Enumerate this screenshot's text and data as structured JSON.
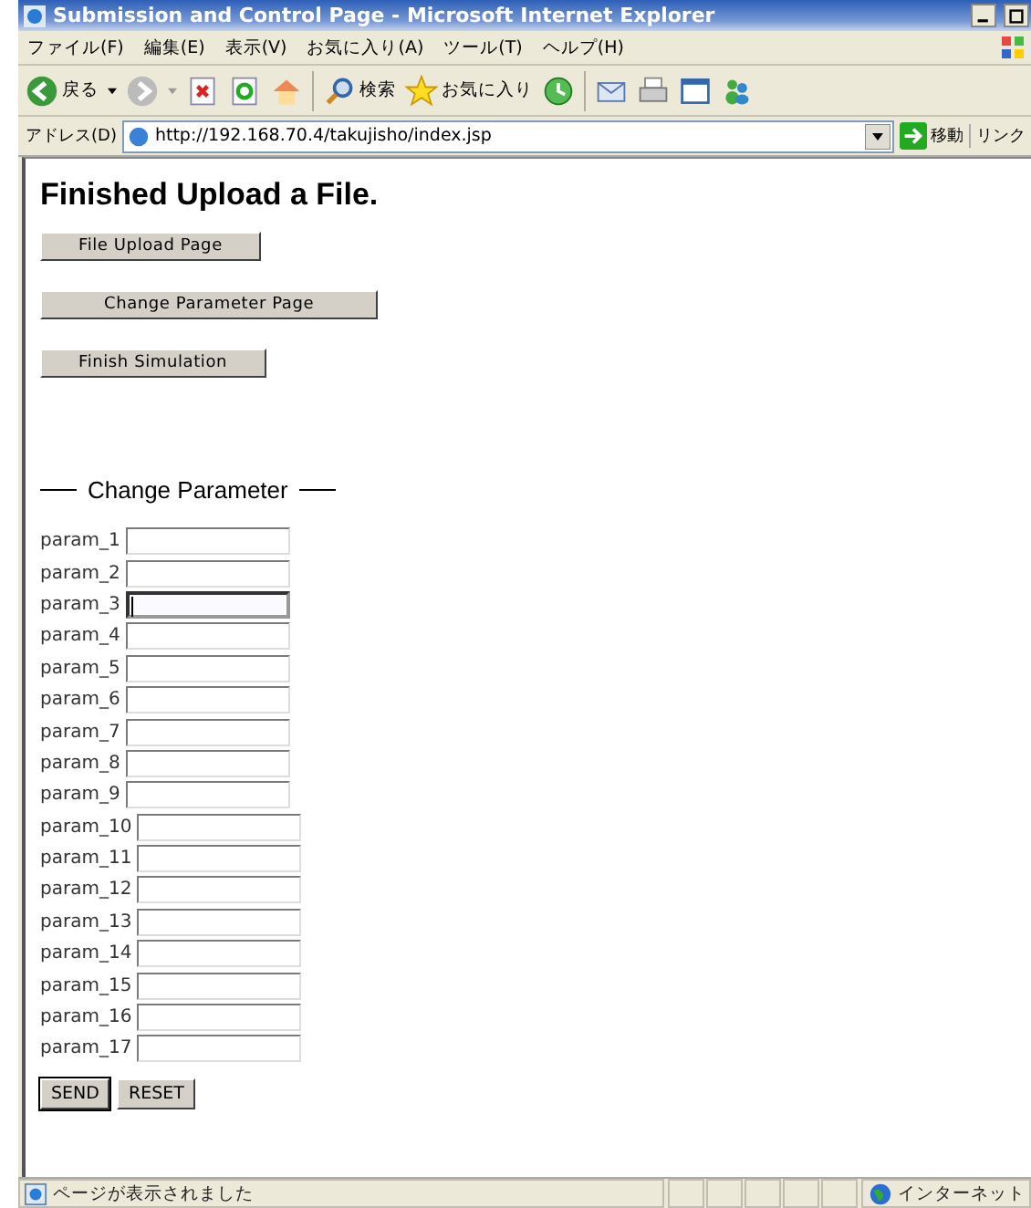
{
  "window": {
    "title": "Submission and Control Page - Microsoft Internet Explorer"
  },
  "menu": [
    "ファイル(F)",
    "編集(E)",
    "表示(V)",
    "お気に入り(A)",
    "ツール(T)",
    "ヘルプ(H)"
  ],
  "toolbar": {
    "back": "戻る",
    "search": "検索",
    "favorites": "お気に入り"
  },
  "address": {
    "label": "アドレス(D)",
    "value": "http://192.168.70.4/takujisho/index.jsp",
    "go": "移動",
    "links": "リンク"
  },
  "page": {
    "heading": "Finished Upload a File.",
    "nav_buttons": [
      "File Upload Page",
      "Change Parameter Page",
      "Finish Simulation"
    ],
    "section_title": "Change Parameter",
    "params": [
      {
        "label": "param_1",
        "focused": false
      },
      {
        "label": "param_2",
        "focused": false
      },
      {
        "label": "param_3",
        "focused": true
      },
      {
        "label": "param_4",
        "focused": false
      },
      {
        "label": "param_5",
        "focused": false
      },
      {
        "label": "param_6",
        "focused": false
      },
      {
        "label": "param_7",
        "focused": false
      },
      {
        "label": "param_8",
        "focused": false
      },
      {
        "label": "param_9",
        "focused": false
      },
      {
        "label": "param_10",
        "focused": false
      },
      {
        "label": "param_11",
        "focused": false
      },
      {
        "label": "param_12",
        "focused": false
      },
      {
        "label": "param_13",
        "focused": false
      },
      {
        "label": "param_14",
        "focused": false
      },
      {
        "label": "param_15",
        "focused": false
      },
      {
        "label": "param_16",
        "focused": false
      },
      {
        "label": "param_17",
        "focused": false
      }
    ],
    "submit": "SEND",
    "reset": "RESET"
  },
  "status_bar": {
    "message": "ページが表示されました",
    "zone": "インターネット"
  }
}
